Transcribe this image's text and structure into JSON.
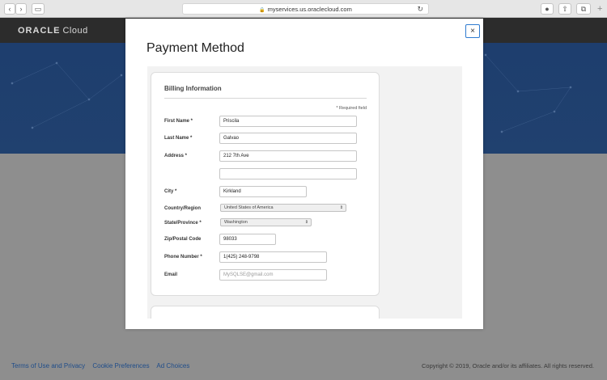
{
  "browser": {
    "url": "myservices.us.oraclecloud.com",
    "back_icon": "chevron-left-icon",
    "forward_icon": "chevron-right-icon",
    "sidebar_icon": "sidebar-icon",
    "lock_icon": "lock-icon",
    "reload_icon": "reload-icon",
    "download_icon": "download-icon",
    "share_icon": "share-icon",
    "tabs_icon": "tabs-icon",
    "new_tab_icon": "plus-icon"
  },
  "header": {
    "logo_brand": "ORACLE",
    "logo_product": "Cloud"
  },
  "footer": {
    "links": [
      "Terms of Use and Privacy",
      "Cookie Preferences",
      "Ad Choices"
    ],
    "copyright": "Copyright © 2019, Oracle and/or its affiliates. All rights reserved."
  },
  "modal": {
    "title": "Payment Method",
    "close_label": "×",
    "billing": {
      "heading": "Billing Information",
      "required_note": "* Required field",
      "first_name_label": "First Name *",
      "first_name_value": "Priscila",
      "last_name_label": "Last Name *",
      "last_name_value": "Galvao",
      "address_label": "Address *",
      "address_value": "212 7th Ave",
      "address2_value": "",
      "city_label": "City *",
      "city_value": "Kirkland",
      "country_label": "Country/Region",
      "country_value": "United States of America",
      "state_label": "State/Province *",
      "state_value": "Washington",
      "zip_label": "Zip/Postal Code",
      "zip_value": "98033",
      "phone_label": "Phone Number *",
      "phone_value": "1(425) 248-9798",
      "email_label": "Email",
      "email_placeholder": "MySQLSE@gmail.com"
    }
  },
  "colors": {
    "header_bar": "#2c2c2c",
    "hero": "#20416f",
    "overlay": "#8e8e8e",
    "link": "#1f4d8a",
    "close_border": "#2f7bd0"
  }
}
